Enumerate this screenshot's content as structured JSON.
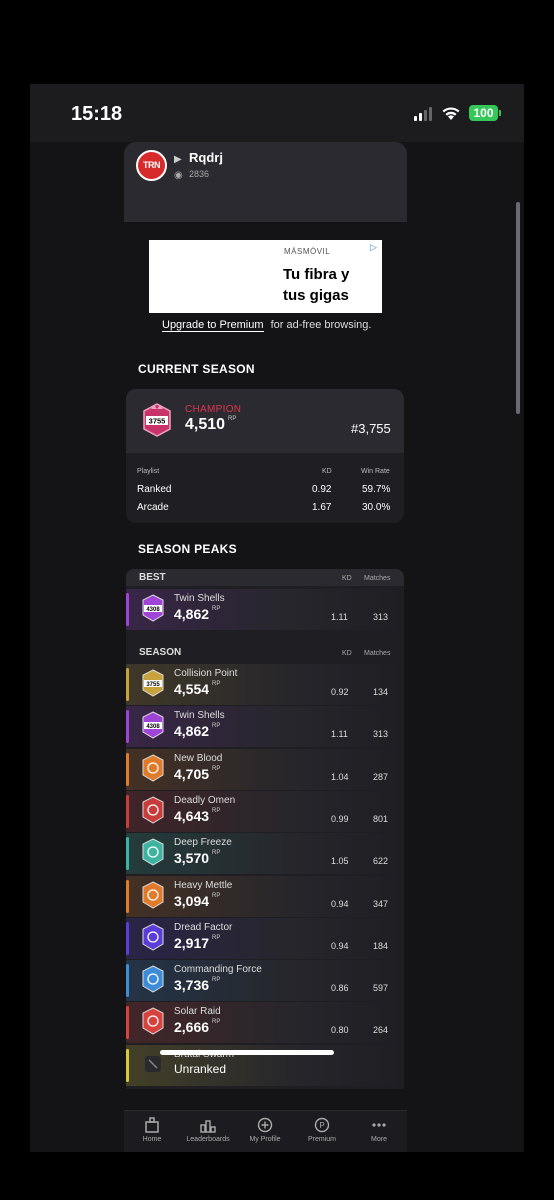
{
  "status_bar": {
    "time": "15:18",
    "battery": "100"
  },
  "profile": {
    "platform_icon": "playstation-icon",
    "username": "Rqdrj",
    "views": "2836",
    "logo": "TRN"
  },
  "ad": {
    "brand": "MÁSMÓVIL",
    "line1": "Tu fibra y",
    "line2": "tus gigas",
    "upgrade_link": "Upgrade to Premium",
    "upgrade_rest": "for ad-free browsing."
  },
  "current_season": {
    "title": "CURRENT SEASON",
    "rank_badge": "3755",
    "rank_name": "CHAMPION",
    "rp": "4,510",
    "rp_unit": "RP",
    "position": "#3,755",
    "headers": {
      "playlist": "Playlist",
      "kd": "KD",
      "win_rate": "Win Rate"
    },
    "rows": [
      {
        "playlist": "Ranked",
        "kd": "0.92",
        "win_rate": "59.7%"
      },
      {
        "playlist": "Arcade",
        "kd": "1.67",
        "win_rate": "30.0%"
      }
    ]
  },
  "season_peaks": {
    "title": "SEASON PEAKS",
    "best_label": "BEST",
    "season_label": "SEASON",
    "kd_label": "KD",
    "matches_label": "Matches",
    "rp_unit": "RP",
    "best": {
      "season": "Twin Shells",
      "badge": "4308",
      "rp": "4,862",
      "kd": "1.11",
      "matches": "313",
      "color": "#a044d8"
    },
    "seasons": [
      {
        "season": "Collision Point",
        "badge": "3755",
        "rp": "4,554",
        "kd": "0.92",
        "matches": "134",
        "color": "#c8a23c"
      },
      {
        "season": "Twin Shells",
        "badge": "4308",
        "rp": "4,862",
        "kd": "1.11",
        "matches": "313",
        "color": "#a044d8"
      },
      {
        "season": "New Blood",
        "badge": "",
        "rp": "4,705",
        "kd": "1.04",
        "matches": "287",
        "color": "#e07b2c"
      },
      {
        "season": "Deadly Omen",
        "badge": "",
        "rp": "4,643",
        "kd": "0.99",
        "matches": "801",
        "color": "#c83c3c"
      },
      {
        "season": "Deep Freeze",
        "badge": "",
        "rp": "3,570",
        "kd": "1.05",
        "matches": "622",
        "color": "#3cb4a0"
      },
      {
        "season": "Heavy Mettle",
        "badge": "",
        "rp": "3,094",
        "kd": "0.94",
        "matches": "347",
        "color": "#e07b2c"
      },
      {
        "season": "Dread Factor",
        "badge": "",
        "rp": "2,917",
        "kd": "0.94",
        "matches": "184",
        "color": "#5a3cd8"
      },
      {
        "season": "Commanding Force",
        "badge": "",
        "rp": "3,736",
        "kd": "0.86",
        "matches": "597",
        "color": "#3c8cd8"
      },
      {
        "season": "Solar Raid",
        "badge": "",
        "rp": "2,666",
        "kd": "0.80",
        "matches": "264",
        "color": "#d8423c"
      },
      {
        "season": "Brutal Swarm",
        "badge": "",
        "rp": "Unranked",
        "kd": "",
        "matches": "",
        "color": "#d8c83c"
      }
    ]
  },
  "nav": [
    {
      "label": "Home",
      "icon": "home-icon"
    },
    {
      "label": "Leaderboards",
      "icon": "leaderboards-icon"
    },
    {
      "label": "My Profile",
      "icon": "plus-circle-icon"
    },
    {
      "label": "Premium",
      "icon": "premium-icon"
    },
    {
      "label": "More",
      "icon": "more-icon"
    }
  ]
}
